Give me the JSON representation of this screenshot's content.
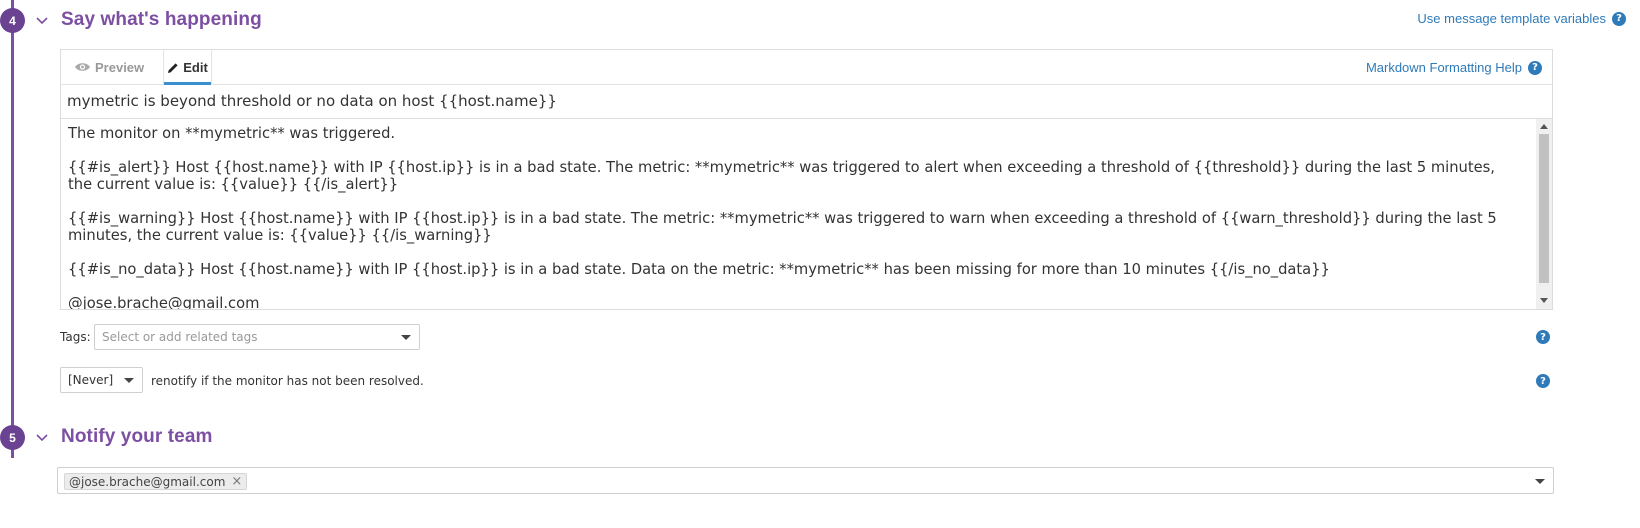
{
  "step4": {
    "number": "4",
    "title": "Say what's happening",
    "template_vars_link": "Use message template variables",
    "tabs": {
      "preview": "Preview",
      "edit": "Edit"
    },
    "markdown_help": "Markdown Formatting Help",
    "subject": "mymetric is beyond threshold or no data on host {{host.name}}",
    "body_paragraphs": [
      "The monitor on **mymetric** was triggered.",
      "{{#is_alert}} Host {{host.name}} with IP {{host.ip}} is in a bad state. The metric: **mymetric** was triggered to alert when exceeding a threshold of {{threshold}} during the last 5 minutes, the current value is: {{value}} {{/is_alert}}",
      "{{#is_warning}} Host {{host.name}} with IP {{host.ip}} is in a bad state. The metric: **mymetric** was triggered to warn when exceeding a threshold of {{warn_threshold}} during the last 5 minutes, the current value is: {{value}} {{/is_warning}}",
      "{{#is_no_data}} Host {{host.name}} with IP {{host.ip}} is in a bad state. Data on the metric: **mymetric** has been missing for more than 10 minutes {{/is_no_data}}",
      "@jose.brache@gmail.com"
    ],
    "tags_label": "Tags:",
    "tags_placeholder": "Select or add related tags",
    "renotify_value": "[Never]",
    "renotify_text": "renotify if the monitor has not been resolved."
  },
  "step5": {
    "number": "5",
    "title": "Notify your team",
    "recipients": [
      "@jose.brache@gmail.com"
    ]
  },
  "colors": {
    "accent": "#7d4fa3",
    "link": "#2f7ab8",
    "tab_underline": "#3a8fd1"
  }
}
